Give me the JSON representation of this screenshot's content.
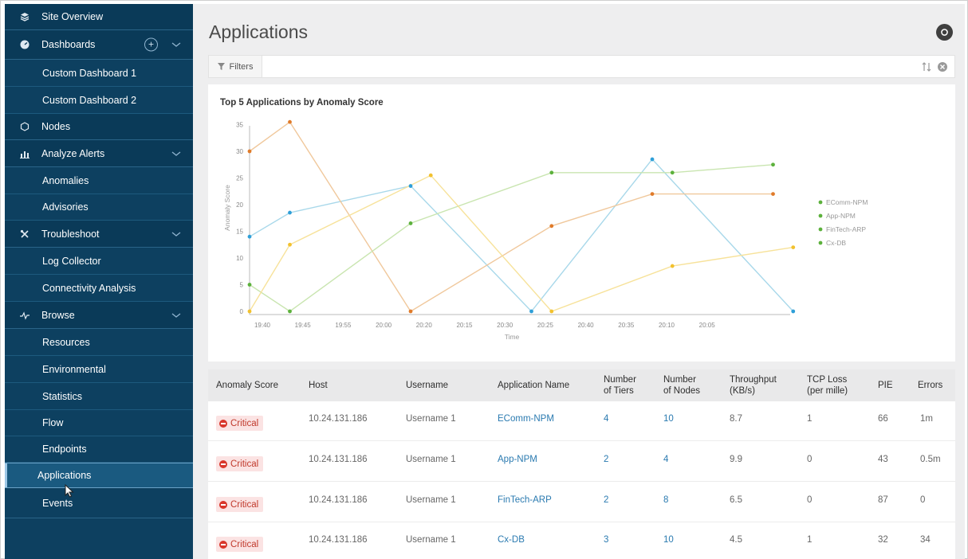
{
  "sidebar": {
    "site_overview": "Site Overview",
    "dashboards": "Dashboards",
    "custom_dashboard_1": "Custom Dashboard 1",
    "custom_dashboard_2": "Custom Dashboard 2",
    "nodes": "Nodes",
    "analyze_alerts": "Analyze Alerts",
    "anomalies": "Anomalies",
    "advisories": "Advisories",
    "troubleshoot": "Troubleshoot",
    "log_collector": "Log Collector",
    "connectivity_analysis": "Connectivity Analysis",
    "browse": "Browse",
    "resources": "Resources",
    "environmental": "Environmental",
    "statistics": "Statistics",
    "flow": "Flow",
    "endpoints": "Endpoints",
    "applications": "Applications",
    "events": "Events"
  },
  "header": {
    "title": "Applications"
  },
  "filter": {
    "label": "Filters"
  },
  "chart_data": {
    "type": "line",
    "title": "Top 5 Applications by Anomaly Score",
    "xlabel": "Time",
    "ylabel": "Anomaly Score",
    "x_ticks": [
      "19:40",
      "19:45",
      "19:55",
      "20:00",
      "20:20",
      "20:15",
      "20:30",
      "20:25",
      "20:40",
      "20:35",
      "20:10",
      "20:05"
    ],
    "y_ticks": [
      0,
      5,
      10,
      15,
      20,
      25,
      30,
      35
    ],
    "ylim": [
      0,
      36
    ],
    "legend_position": "right",
    "series": [
      {
        "name": "EComm-NPM",
        "color": "#a8d8ea",
        "point_color": "#2e9fd8",
        "points": [
          [
            0,
            14
          ],
          [
            1,
            18.5
          ],
          [
            4,
            23.5
          ],
          [
            7,
            0
          ],
          [
            10,
            28.5
          ],
          [
            13.5,
            0
          ]
        ]
      },
      {
        "name": "App-NPM",
        "color": "#f0c89c",
        "point_color": "#e07b2a",
        "points": [
          [
            0,
            30
          ],
          [
            1,
            35.5
          ],
          [
            4,
            0
          ],
          [
            7.5,
            16
          ],
          [
            10,
            22
          ],
          [
            13,
            22
          ]
        ]
      },
      {
        "name": "FinTech-ARP",
        "color": "#c9e5b0",
        "point_color": "#5cb13c",
        "points": [
          [
            0,
            5
          ],
          [
            1,
            0
          ],
          [
            4,
            16.5
          ],
          [
            7.5,
            26
          ],
          [
            10.5,
            26
          ],
          [
            13,
            27.5
          ]
        ]
      },
      {
        "name": "Cx-DB",
        "color": "#f7e29a",
        "point_color": "#f2c12e",
        "points": [
          [
            0,
            0
          ],
          [
            1,
            12.5
          ],
          [
            4.5,
            25.5
          ],
          [
            7.5,
            0
          ],
          [
            10.5,
            8.5
          ],
          [
            13.5,
            12
          ]
        ]
      }
    ]
  },
  "table": {
    "headers": {
      "anomaly_score": "Anomaly Score",
      "host": "Host",
      "username": "Username",
      "application_name": "Application Name",
      "tiers_1": "Number",
      "tiers_2": "of Tiers",
      "nodes_1": "Number",
      "nodes_2": "of Nodes",
      "throughput_1": "Throughput",
      "throughput_2": "(KB/s)",
      "tcp_1": "TCP Loss",
      "tcp_2": "(per mille)",
      "pie": "PIE",
      "errors": "Errors"
    },
    "rows": [
      {
        "score": "Critical",
        "host": "10.24.131.186",
        "username": "Username 1",
        "app": "EComm-NPM",
        "tiers": "4",
        "nodes": "10",
        "throughput": "8.7",
        "tcp": "1",
        "pie": "66",
        "errors": "1m"
      },
      {
        "score": "Critical",
        "host": "10.24.131.186",
        "username": "Username 1",
        "app": "App-NPM",
        "tiers": "2",
        "nodes": "4",
        "throughput": "9.9",
        "tcp": "0",
        "pie": "43",
        "errors": "0.5m"
      },
      {
        "score": "Critical",
        "host": "10.24.131.186",
        "username": "Username 1",
        "app": "FinTech-ARP",
        "tiers": "2",
        "nodes": "8",
        "throughput": "6.5",
        "tcp": "0",
        "pie": "87",
        "errors": "0"
      },
      {
        "score": "Critical",
        "host": "10.24.131.186",
        "username": "Username 1",
        "app": "Cx-DB",
        "tiers": "3",
        "nodes": "10",
        "throughput": "4.5",
        "tcp": "1",
        "pie": "32",
        "errors": "34"
      }
    ]
  }
}
